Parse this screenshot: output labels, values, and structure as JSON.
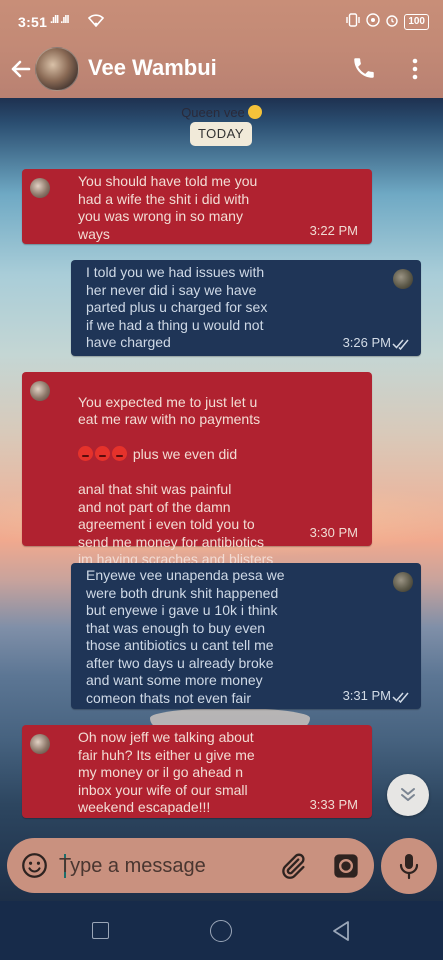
{
  "status_bar": {
    "time": "3:51",
    "signal": ".ıll .ıll",
    "battery": "100"
  },
  "header": {
    "contact_name": "Vee Wambui",
    "icons": [
      "back-arrow-icon",
      "avatar",
      "phone-icon",
      "more-vert-icon"
    ]
  },
  "chat": {
    "subtitle": "Queen vee",
    "date_label": "TODAY",
    "messages": [
      {
        "direction": "incoming",
        "text": "You should have told me you\nhad a wife the shit i did with\nyou was wrong in so many\nways",
        "time": "3:22 PM"
      },
      {
        "direction": "outgoing",
        "text": "I told  you we had issues with\nher never did i say we have\nparted plus u charged for sex\nif we had a thing u would  not\nhave charged",
        "time": "3:26 PM",
        "status": "read"
      },
      {
        "direction": "incoming",
        "text_before": "You expected me to just let u\neat me raw with no payments",
        "text_mid": " plus we even did",
        "text_after": "anal that shit was painful\nand not part of the damn\nagreement i even told you to\nsend me money for antibiotics\nim having scraches and blisters",
        "time": "3:30 PM"
      },
      {
        "direction": "outgoing",
        "text": "Enyewe vee unapenda pesa we\nwere both drunk shit happened\nbut enyewe i gave u 10k i think\nthat was enough to buy even\nthose antibiotics u cant tell me\nafter two days u already broke\nand want some more money\ncomeon thats not even fair",
        "time": "3:31 PM",
        "status": "read"
      },
      {
        "direction": "incoming",
        "text": "Oh now jeff we talking about\nfair huh?  Its either u give me\nmy money or il go ahead n\ninbox your wife of our small\nweekend escapade!!!",
        "time": "3:33 PM"
      }
    ]
  },
  "composer": {
    "placeholder": "Type a message"
  },
  "colors": {
    "incoming_bubble": "#b02230",
    "outgoing_bubble": "#1f3557",
    "header": "#c38a76",
    "nav_bar": "#172b4a"
  }
}
